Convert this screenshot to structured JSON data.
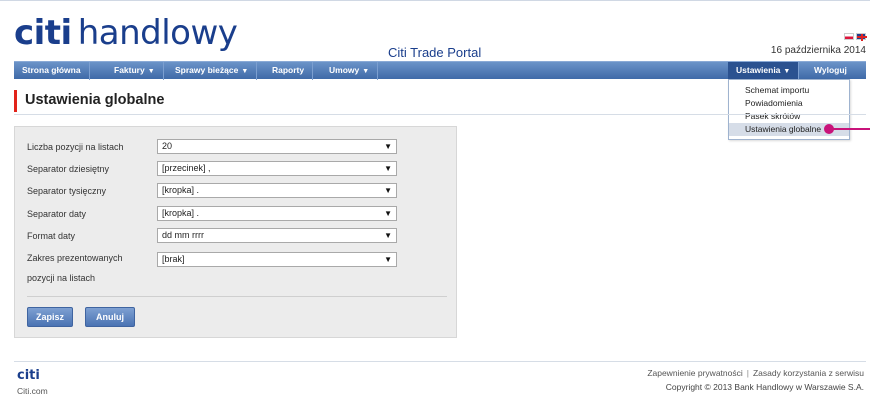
{
  "header": {
    "logo_citi": "citi",
    "logo_name": "handlowy",
    "portal_title": "Citi Trade Portal",
    "date": "16 października 2014"
  },
  "nav": {
    "items": [
      {
        "label": "Strona główna",
        "has_dropdown": false
      },
      {
        "label": "Faktury",
        "has_dropdown": true
      },
      {
        "label": "Sprawy bieżące",
        "has_dropdown": true
      },
      {
        "label": "Raporty",
        "has_dropdown": false
      },
      {
        "label": "Umowy",
        "has_dropdown": true
      },
      {
        "label": "Ustawienia",
        "has_dropdown": true,
        "active": true
      },
      {
        "label": "Wyloguj",
        "has_dropdown": false
      }
    ],
    "caret": "▼"
  },
  "settings_menu": {
    "items": [
      {
        "label": "Schemat importu"
      },
      {
        "label": "Powiadomienia"
      },
      {
        "label": "Pasek skrótów"
      },
      {
        "label": "Ustawienia globalne",
        "selected": true
      }
    ]
  },
  "page": {
    "title": "Ustawienia globalne"
  },
  "form": {
    "fields": [
      {
        "label": "Liczba pozycji na listach",
        "value": "20"
      },
      {
        "label": "Separator dziesiętny",
        "value": "[przecinek] ,"
      },
      {
        "label": "Separator tysięczny",
        "value": "[kropka] ."
      },
      {
        "label": "Separator daty",
        "value": "[kropka] ."
      },
      {
        "label": "Format daty",
        "value": "dd mm rrrr"
      },
      {
        "label": "Zakres prezentowanych",
        "label_line2": "pozycji na listach",
        "value": "[brak]"
      }
    ],
    "save_label": "Zapisz",
    "cancel_label": "Anuluj",
    "select_arrow": "▼"
  },
  "footer": {
    "logo": "citi",
    "site": "Citi.com",
    "privacy_link": "Zapewnienie prywatności",
    "separator": "|",
    "terms_link": "Zasady korzystania z serwisu",
    "copyright": "Copyright © 2013 Bank Handlowy w Warszawie S.A."
  },
  "colors": {
    "brand_blue": "#1a3e8c",
    "brand_red": "#e2231a",
    "nav_bar": "#4f78b6",
    "highlight_pointer": "#c8137a"
  }
}
